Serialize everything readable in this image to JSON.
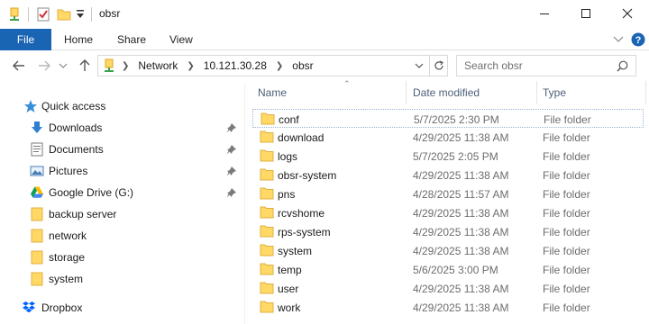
{
  "window": {
    "title": "obsr"
  },
  "ribbon": {
    "tabs": [
      {
        "label": "File"
      },
      {
        "label": "Home"
      },
      {
        "label": "Share"
      },
      {
        "label": "View"
      }
    ]
  },
  "address": {
    "crumbs": [
      "Network",
      "10.121.30.28",
      "obsr"
    ]
  },
  "search": {
    "placeholder": "Search obsr"
  },
  "nav": {
    "quick_access": "Quick access",
    "items": [
      {
        "label": "Downloads",
        "icon": "download-arrow-icon",
        "pinned": true
      },
      {
        "label": "Documents",
        "icon": "documents-icon",
        "pinned": true
      },
      {
        "label": "Pictures",
        "icon": "pictures-icon",
        "pinned": true
      },
      {
        "label": "Google Drive (G:)",
        "icon": "google-drive-icon",
        "pinned": true
      },
      {
        "label": "backup server",
        "icon": "folder-icon",
        "pinned": false
      },
      {
        "label": "network",
        "icon": "folder-icon",
        "pinned": false
      },
      {
        "label": "storage",
        "icon": "folder-icon",
        "pinned": false
      },
      {
        "label": "system",
        "icon": "folder-icon",
        "pinned": false
      }
    ],
    "dropbox": "Dropbox"
  },
  "list": {
    "columns": {
      "name": "Name",
      "date": "Date modified",
      "type": "Type"
    },
    "rows": [
      {
        "name": "conf",
        "date": "5/7/2025 2:30 PM",
        "type": "File folder"
      },
      {
        "name": "download",
        "date": "4/29/2025 11:38 AM",
        "type": "File folder"
      },
      {
        "name": "logs",
        "date": "5/7/2025 2:05 PM",
        "type": "File folder"
      },
      {
        "name": "obsr-system",
        "date": "4/29/2025 11:38 AM",
        "type": "File folder"
      },
      {
        "name": "pns",
        "date": "4/28/2025 11:57 AM",
        "type": "File folder"
      },
      {
        "name": "rcvshome",
        "date": "4/29/2025 11:38 AM",
        "type": "File folder"
      },
      {
        "name": "rps-system",
        "date": "4/29/2025 11:38 AM",
        "type": "File folder"
      },
      {
        "name": "system",
        "date": "4/29/2025 11:38 AM",
        "type": "File folder"
      },
      {
        "name": "temp",
        "date": "5/6/2025 3:00 PM",
        "type": "File folder"
      },
      {
        "name": "user",
        "date": "4/29/2025 11:38 AM",
        "type": "File folder"
      },
      {
        "name": "work",
        "date": "4/29/2025 11:38 AM",
        "type": "File folder"
      }
    ]
  },
  "colors": {
    "accent": "#1a64b4",
    "folder": "#ffd865",
    "folder_dark": "#e8b84a",
    "header_text": "#4c607a"
  }
}
